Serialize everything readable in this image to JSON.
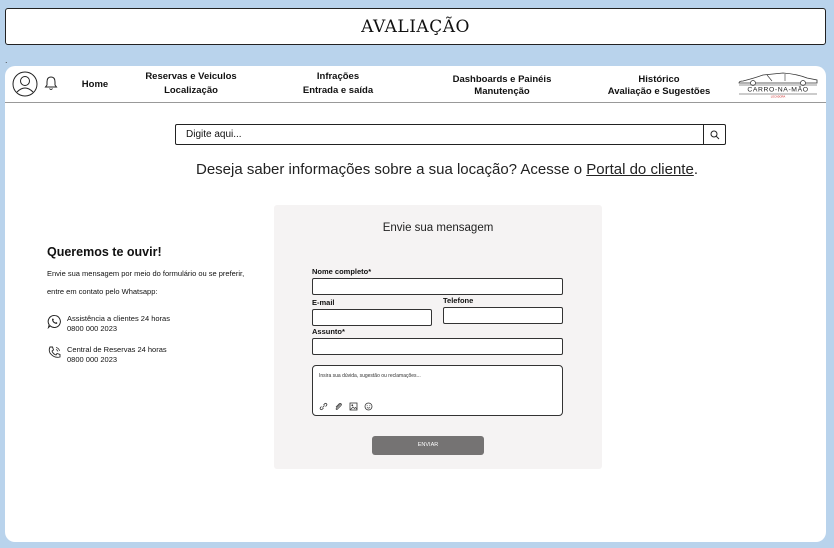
{
  "page_title": "AVALIAÇÃO",
  "top_marker": ".",
  "nav": {
    "items": [
      {
        "line1": "Home",
        "line2": ""
      },
      {
        "line1": "Reservas e Veiculos",
        "line2": "Localização"
      },
      {
        "line1": "Infrações",
        "line2": "Entrada e saída"
      },
      {
        "line1": "Dashboards e Painéis",
        "line2": "Manutenção"
      },
      {
        "line1": "Histórico",
        "line2": "Avaliação e Sugestões"
      }
    ],
    "logo_text": "CARRO-NA-MÃO",
    "logo_subtext": "LOCADORA"
  },
  "search": {
    "placeholder": "Digite aqui..."
  },
  "info": {
    "text": "Deseja saber informações sobre a sua locação? Acesse o ",
    "link": "Portal do cliente",
    "end": "."
  },
  "contact": {
    "heading": "Queremos te ouvir!",
    "line1": "Envie sua mensagem por meio do formulário ou se preferir,",
    "line2": "entre em contato pelo Whatsapp:",
    "items": [
      {
        "label": "Assistência a clientes 24 horas",
        "phone": "0800 000 2023",
        "icon": "whatsapp-icon"
      },
      {
        "label": "Central de Reservas 24 horas",
        "phone": "0800 000 2023",
        "icon": "phone-icon"
      }
    ]
  },
  "form": {
    "title": "Envie sua mensagem",
    "name_label": "Nome completo*",
    "email_label": "E-mail",
    "phone_label": "Telefone",
    "subject_label": "Assunto*",
    "message_placeholder": "Insira sua dúvida, sugestão ou reclamações...",
    "submit_label": "ENVIAR"
  },
  "colors": {
    "background": "#b9d3ec",
    "form_bg": "#f5f3f3",
    "button": "#757373"
  }
}
